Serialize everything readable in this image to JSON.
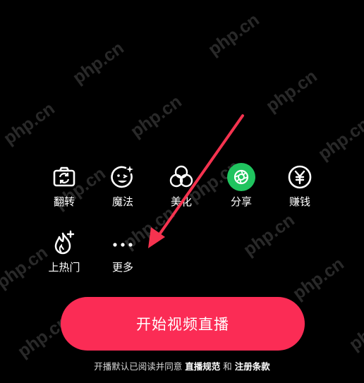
{
  "watermark": {
    "text": "php.cn"
  },
  "tools": [
    {
      "label": "翻转",
      "icon": "flip-camera-icon"
    },
    {
      "label": "魔法",
      "icon": "magic-face-icon"
    },
    {
      "label": "美化",
      "icon": "beautify-icon"
    },
    {
      "label": "分享",
      "icon": "share-shutter-icon"
    },
    {
      "label": "赚钱",
      "icon": "yuan-coin-icon"
    },
    {
      "label": "上热门",
      "icon": "flame-plus-icon"
    },
    {
      "label": "更多",
      "icon": "more-dots-icon"
    }
  ],
  "start_button": {
    "label": "开始视频直播"
  },
  "agreement": {
    "prefix": "开播默认已阅读并同意",
    "link1": "直播规范",
    "and": "和",
    "link2": "注册条款"
  },
  "colors": {
    "background": "#000000",
    "accent": "#fb2c55",
    "share_green": "#20c45f",
    "annotation_arrow": "#f5334f"
  }
}
